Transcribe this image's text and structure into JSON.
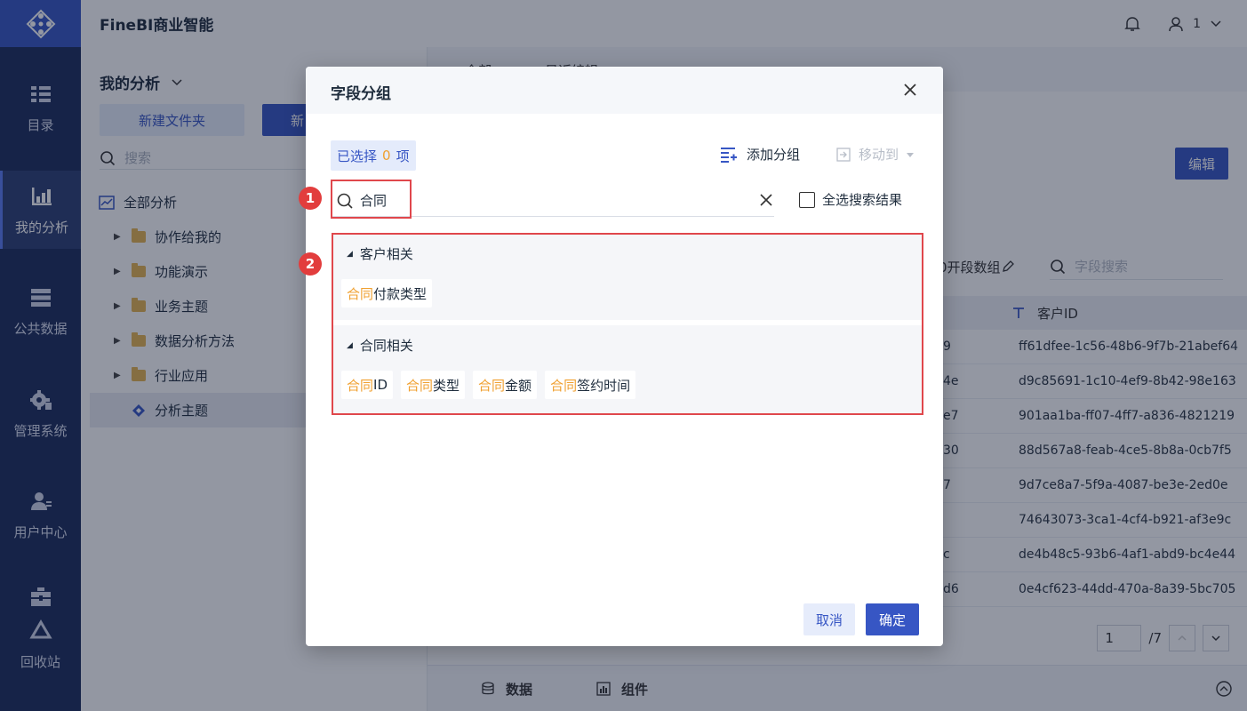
{
  "header": {
    "brand": "FineBI商业智能",
    "user_name": "1"
  },
  "nav": {
    "items": [
      {
        "label": "目录"
      },
      {
        "label": "我的分析"
      },
      {
        "label": "公共数据"
      },
      {
        "label": "管理系统"
      },
      {
        "label": "用户中心"
      },
      {
        "label": "回收站"
      }
    ]
  },
  "panel": {
    "title": "我的分析",
    "new_folder": "新建文件夹",
    "new_stub": "新",
    "search_placeholder": "搜索",
    "tree": [
      {
        "label": "全部分析"
      },
      {
        "label": "协作给我的"
      },
      {
        "label": "功能演示"
      },
      {
        "label": "业务主题"
      },
      {
        "label": "数据分析方法"
      },
      {
        "label": "行业应用"
      },
      {
        "label": "分析主题"
      }
    ]
  },
  "main": {
    "tabs": [
      {
        "label": "全部"
      },
      {
        "label": "最近编辑"
      }
    ],
    "edit_button": "编辑",
    "stub_label": "0开段数组",
    "field_search_placeholder": "字段搜索",
    "column_header": "客户ID",
    "rows": [
      {
        "a": "9",
        "b": "ff61dfee-1c56-48b6-9f7b-21abef64"
      },
      {
        "a": "4e",
        "b": "d9c85691-1c10-4ef9-8b42-98e163"
      },
      {
        "a": "e7",
        "b": "901aa1ba-ff07-4ff7-a836-4821219"
      },
      {
        "a": "30",
        "b": "88d567a8-feab-4ce5-8b8a-0cb7f5"
      },
      {
        "a": "7",
        "b": "9d7ce8a7-5f9a-4087-be3e-2ed0e"
      },
      {
        "a": "",
        "b": "74643073-3ca1-4cf4-b921-af3e9c"
      },
      {
        "a": "c",
        "b": "de4b48c5-93b6-4af1-abd9-bc4e44"
      },
      {
        "a": "d6",
        "b": "0e4cf623-44dd-470a-8a39-5bc705"
      }
    ],
    "pager": {
      "page": "1",
      "total": "/7"
    },
    "bottom_tabs": [
      {
        "label": "数据"
      },
      {
        "label": "组件"
      }
    ]
  },
  "dialog": {
    "title": "字段分组",
    "selected_prefix": "已选择",
    "selected_count": "0",
    "selected_suffix": "项",
    "add_group": "添加分组",
    "move_to": "移动到",
    "search_value": "合同",
    "select_all": "全选搜索结果",
    "badge1": "1",
    "badge2": "2",
    "groups": [
      {
        "name": "客户相关",
        "fields": [
          {
            "match": "合同",
            "rest": "付款类型"
          }
        ]
      },
      {
        "name": "合同相关",
        "fields": [
          {
            "match": "合同",
            "rest": "ID"
          },
          {
            "match": "合同",
            "rest": "类型"
          },
          {
            "match": "合同",
            "rest": "金额"
          },
          {
            "match": "合同",
            "rest": "签约时间"
          }
        ]
      }
    ],
    "cancel": "取消",
    "confirm": "确定"
  },
  "colors": {
    "accent": "#3756c4",
    "highlight_text": "#f0a030",
    "annotation_red": "#e0474c",
    "nav_bg": "#1c2c5b"
  }
}
